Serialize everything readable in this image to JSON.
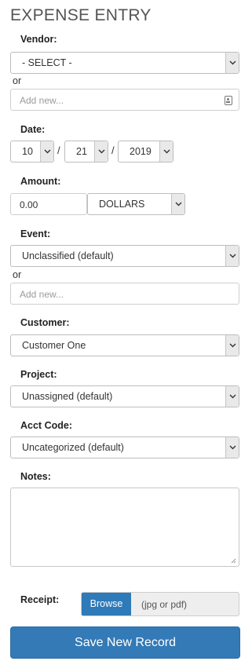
{
  "title": "EXPENSE ENTRY",
  "vendor": {
    "label": "Vendor:",
    "selected": "- SELECT -",
    "or": "or",
    "add_placeholder": "Add new..."
  },
  "date": {
    "label": "Date:",
    "month": "10",
    "day": "21",
    "year": "2019",
    "separator": "/"
  },
  "amount": {
    "label": "Amount:",
    "value": "0.00",
    "currency": "DOLLARS"
  },
  "event": {
    "label": "Event:",
    "selected": "Unclassified (default)",
    "or": "or",
    "add_placeholder": "Add new..."
  },
  "customer": {
    "label": "Customer:",
    "selected": "Customer One"
  },
  "project": {
    "label": "Project:",
    "selected": "Unassigned (default)"
  },
  "acct_code": {
    "label": "Acct Code:",
    "selected": "Uncategorized (default)"
  },
  "notes": {
    "label": "Notes:"
  },
  "receipt": {
    "label": "Receipt:",
    "browse_label": "Browse",
    "hint": "(jpg or pdf)"
  },
  "save_label": "Save New Record",
  "colors": {
    "primary": "#337ab7",
    "browse": "#2f7ab8"
  },
  "icons": {
    "dropdown": "chevron-down-icon",
    "contact": "contact-card-icon",
    "resize": "resize-grip-icon"
  }
}
